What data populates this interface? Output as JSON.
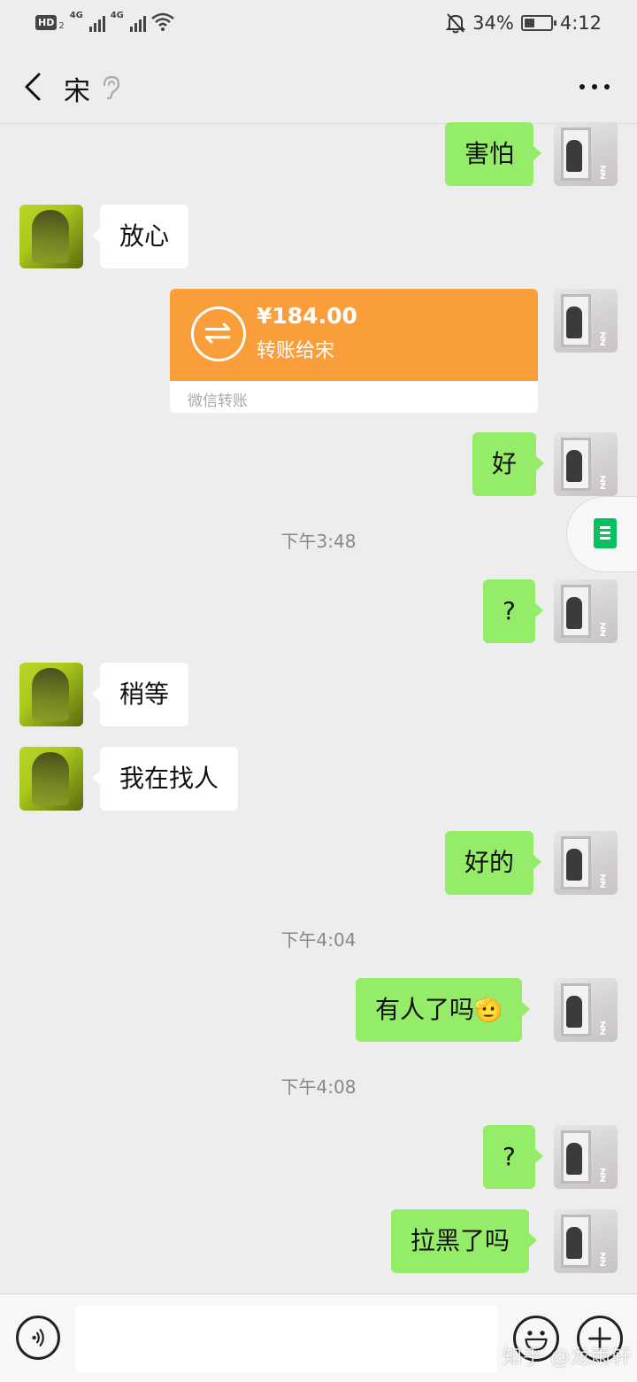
{
  "status_bar": {
    "hd_label": "HD",
    "hd_sub": "2",
    "network_1": "4G",
    "network_2": "4G",
    "battery_text": "34%",
    "battery_level": 0.34,
    "time": "4:12"
  },
  "header": {
    "title": "宋"
  },
  "messages": [
    {
      "side": "right",
      "text": "害怕"
    },
    {
      "side": "left",
      "text": "放心"
    },
    {
      "side": "right",
      "type": "transfer",
      "amount": "¥184.00",
      "desc": "转账给宋",
      "source": "微信转账"
    },
    {
      "side": "right",
      "text": "好"
    },
    {
      "type": "time",
      "text": "下午3:48"
    },
    {
      "side": "right",
      "text": "?"
    },
    {
      "side": "left",
      "text": "稍等"
    },
    {
      "side": "left",
      "text": "我在找人"
    },
    {
      "side": "right",
      "text": "好的"
    },
    {
      "type": "time",
      "text": "下午4:04"
    },
    {
      "side": "right",
      "text": "有人了吗",
      "emoji": "🫡"
    },
    {
      "type": "time",
      "text": "下午4:08"
    },
    {
      "side": "right",
      "text": "?"
    },
    {
      "side": "right",
      "text": "拉黑了吗"
    }
  ],
  "input": {
    "value": ""
  },
  "watermark": "知乎 @龙雨轩"
}
